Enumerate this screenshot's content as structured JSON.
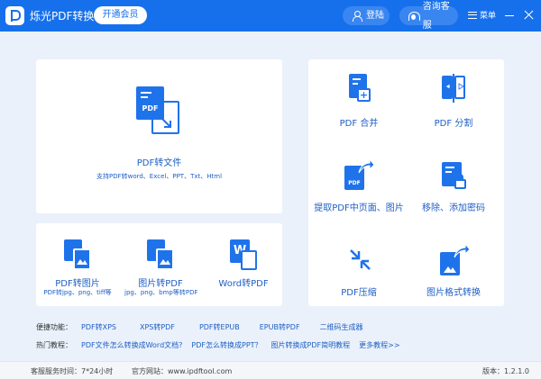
{
  "titlebar": {
    "app_title": "烁光PDF转换器",
    "vip_button": "开通会员",
    "login_button": "登陆",
    "service_button": "咨询客服",
    "menu_label": "菜单"
  },
  "colors": {
    "brand": "#1670ec",
    "link": "#1f5fc4",
    "background": "#eaf1fb"
  },
  "main_tile": {
    "label": "PDF转文件",
    "description": "支持PDF转word、Excel、PPT、Txt、Html",
    "icon_text": "PDF"
  },
  "image_tiles": [
    {
      "label": "PDF转图片",
      "description": "PDF转jpg、png、tiff等"
    },
    {
      "label": "图片转PDF",
      "description": "jpg、png、bmp等转PDF"
    },
    {
      "label": "Word转PDF",
      "description": ""
    }
  ],
  "tool_tiles": [
    {
      "label": "PDF 合并",
      "icon": "pdf-merge-icon"
    },
    {
      "label": "PDF 分割",
      "icon": "pdf-split-icon"
    },
    {
      "label": "提取PDF中页面、图片",
      "icon": "pdf-extract-icon",
      "icon_text": "PDF"
    },
    {
      "label": "移除、添加密码",
      "icon": "lock-icon"
    },
    {
      "label": "PDF压缩",
      "icon": "compress-icon"
    },
    {
      "label": "图片格式转换",
      "icon": "image-convert-icon"
    }
  ],
  "quick_functions": {
    "label": "便捷功能：",
    "links": [
      "PDF转XPS",
      "XPS转PDF",
      "PDF转EPUB",
      "EPUB转PDF",
      "二维码生成器"
    ]
  },
  "tutorials": {
    "label": "热门教程：",
    "links": [
      "PDF文件怎么转换成Word文档?",
      "PDF怎么转换成PPT？",
      "图片转换成PDF简明教程",
      "更多教程>>"
    ]
  },
  "statusbar": {
    "service_hours": "客服服务时间：7*24小时",
    "website": "官方网站：www.ipdftool.com",
    "version": "版本：1.2.1.0"
  }
}
